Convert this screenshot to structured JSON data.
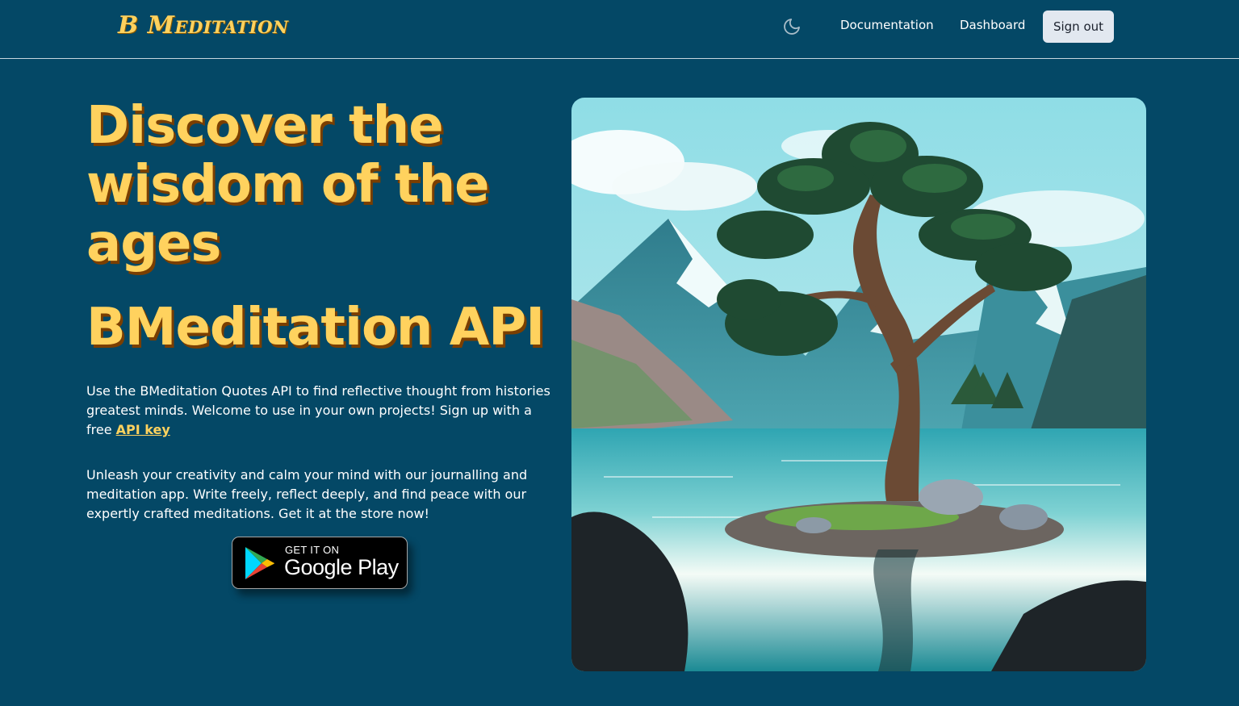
{
  "header": {
    "logo": "B Meditation",
    "nav": {
      "documentation": "Documentation",
      "dashboard": "Dashboard"
    },
    "signout_label": "Sign out",
    "theme_icon": "moon-icon"
  },
  "hero": {
    "title": "Discover the wisdom of the ages",
    "subtitle": "BMeditation API",
    "paragraph1_text": "Use the BMeditation Quotes API to find reflective thought from histories greatest minds. Welcome to use in your own projects! Sign up with a free ",
    "paragraph1_link": "API key",
    "paragraph2": "Unleash your creativity and calm your mind with our journalling and meditation app. Write freely, reflect deeply, and find peace with our expertly crafted meditations. Get it at the store now!",
    "store_badge": {
      "small_text": "GET IT ON",
      "big_text": "Google Play",
      "icon": "google-play-icon"
    }
  },
  "colors": {
    "background": "#044866",
    "accent": "#ffd25e",
    "signout_bg": "#e2e8f0"
  }
}
